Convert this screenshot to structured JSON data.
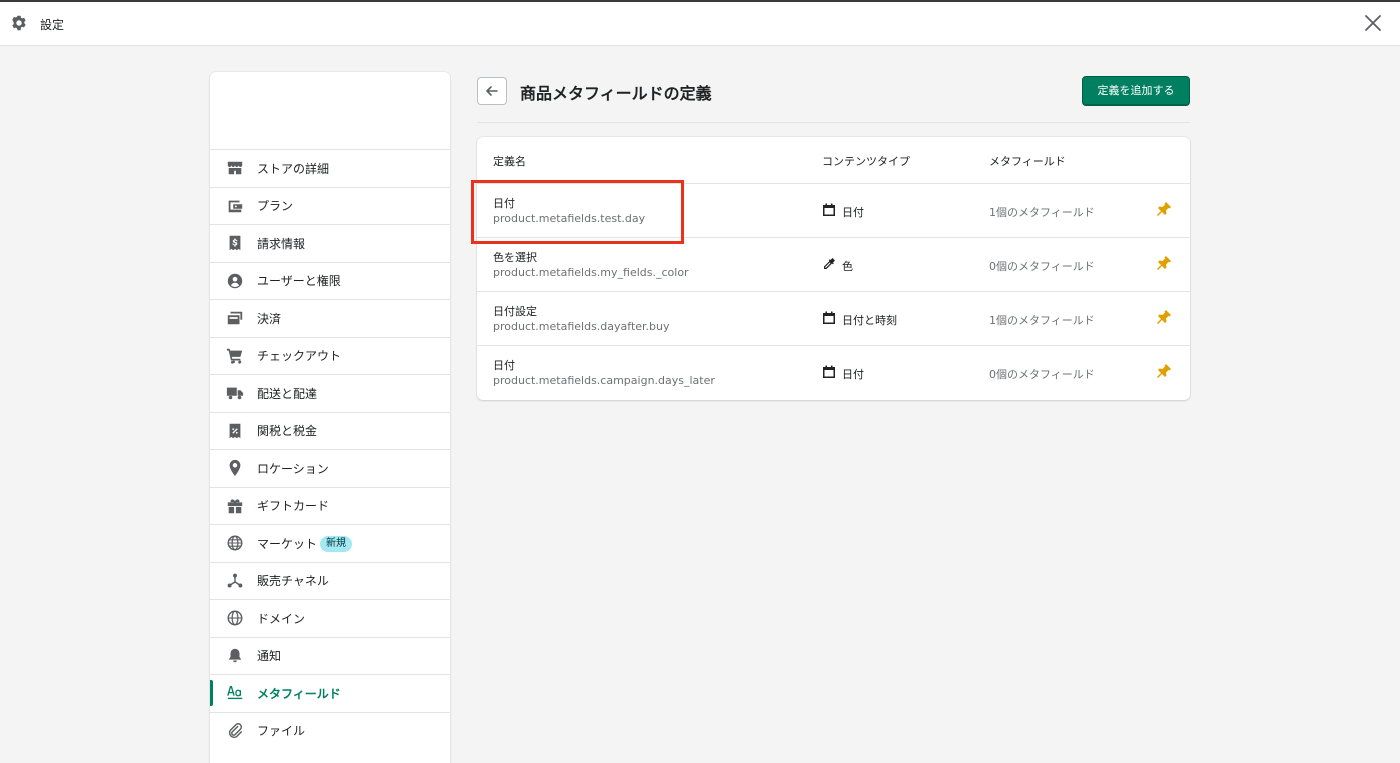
{
  "window": {
    "title": "設定"
  },
  "sidebar": {
    "items": [
      {
        "label": "ストアの詳細",
        "icon": "store-icon"
      },
      {
        "label": "プラン",
        "icon": "wallet-icon"
      },
      {
        "label": "請求情報",
        "icon": "billing-icon"
      },
      {
        "label": "ユーザーと権限",
        "icon": "user-icon"
      },
      {
        "label": "決済",
        "icon": "payments-icon"
      },
      {
        "label": "チェックアウト",
        "icon": "cart-icon"
      },
      {
        "label": "配送と配達",
        "icon": "truck-icon"
      },
      {
        "label": "関税と税金",
        "icon": "tax-icon"
      },
      {
        "label": "ロケーション",
        "icon": "location-icon"
      },
      {
        "label": "ギフトカード",
        "icon": "gift-icon"
      },
      {
        "label": "マーケット",
        "icon": "globe-icon",
        "badge": "新規"
      },
      {
        "label": "販売チャネル",
        "icon": "channels-icon"
      },
      {
        "label": "ドメイン",
        "icon": "domain-icon"
      },
      {
        "label": "通知",
        "icon": "bell-icon"
      },
      {
        "label": "メタフィールド",
        "icon": "metafields-icon",
        "active": true
      },
      {
        "label": "ファイル",
        "icon": "paperclip-icon"
      }
    ]
  },
  "page": {
    "title": "商品メタフィールドの定義",
    "add_button": "定義を追加する"
  },
  "table": {
    "headers": {
      "name": "定義名",
      "type": "コンテンツタイプ",
      "count": "メタフィールド"
    },
    "rows": [
      {
        "name": "日付",
        "key": "product.metafields.test.day",
        "type": "日付",
        "type_icon": "calendar-icon",
        "count": "1個のメタフィールド"
      },
      {
        "name": "色を選択",
        "key": "product.metafields.my_fields._color",
        "type": "色",
        "type_icon": "eyedropper-icon",
        "count": "0個のメタフィールド"
      },
      {
        "name": "日付設定",
        "key": "product.metafields.dayafter.buy",
        "type": "日付と時刻",
        "type_icon": "calendar-icon",
        "count": "1個のメタフィールド"
      },
      {
        "name": "日付",
        "key": "product.metafields.campaign.days_later",
        "type": "日付",
        "type_icon": "calendar-icon",
        "count": "0個のメタフィールド"
      }
    ]
  },
  "colors": {
    "accent": "#008060",
    "pin": "#e0a100",
    "highlight": "#e8321c",
    "badge": "#a4e8f2"
  }
}
